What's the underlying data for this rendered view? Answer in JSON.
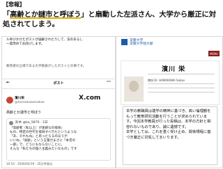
{
  "tag": "【悲報】",
  "headline": {
    "pre": "「",
    "highlight": "高齢とか謎市と呼ぼう",
    "post": "」と扇動した左派さん、大学から厳正に対処されてしまう。"
  },
  "colors": {
    "accent_underline": "#e2b200",
    "brand": "#1f5aa6",
    "menu": "#8b1a1a",
    "avatar": "#c94436"
  },
  "post": {
    "top_line1": "ル呼びかけたポストが誤解されたりして、法のあるし",
    "top_line2": "一度改めてお詫びします。",
    "mid_line": "教育者の立場である大学教員がしたポストとの事です。",
    "header_title": "ポスト",
    "back_icon": "←",
    "more_icon": "⋯",
    "user_name": "濱川栄",
    "handle": "@hamakawasakae",
    "x_logo": "X.com",
    "text": "高齢とか謎市と呼ぼう",
    "quote_name": "鈴木 @ko_5870 · 1日",
    "quote_l1": "「高齢者（私以上）が迷惑なの排除」",
    "quote_l2": "もの、特定の世代を排除すべきだというような",
    "quote_l3": "「あ、それもね」と思ったらるのほうが",
    "quote_l4": "いいね、「高齢」という言葉がまさに「本音の",
    "quote_l5": "一部」で、どうにもならないことに。",
    "quote_l6": "そんな「私たちの個人主義みたいなもの」です",
    "meta": "10:53 · 2026/02/19 · 35万件表示"
  },
  "univ": {
    "logo_line1": "常葉大学",
    "logo_line2": "常葉大学短大部",
    "menu_label": "MENU",
    "name": "濱川 栄",
    "title": "教授 Dr. HAMAKAWA Sakae",
    "statement": [
      "本学の教職員は建学の精神に基づき、高い倫理観をもって教育研究活動を行うことが求められています。今回本学教員が行った投稿は、本学の方針と相容れないものであり、誠に遺憾です。",
      "本学としては、これを重く受け止め、関係規程に基づき厳正に対処してまいります。"
    ]
  }
}
